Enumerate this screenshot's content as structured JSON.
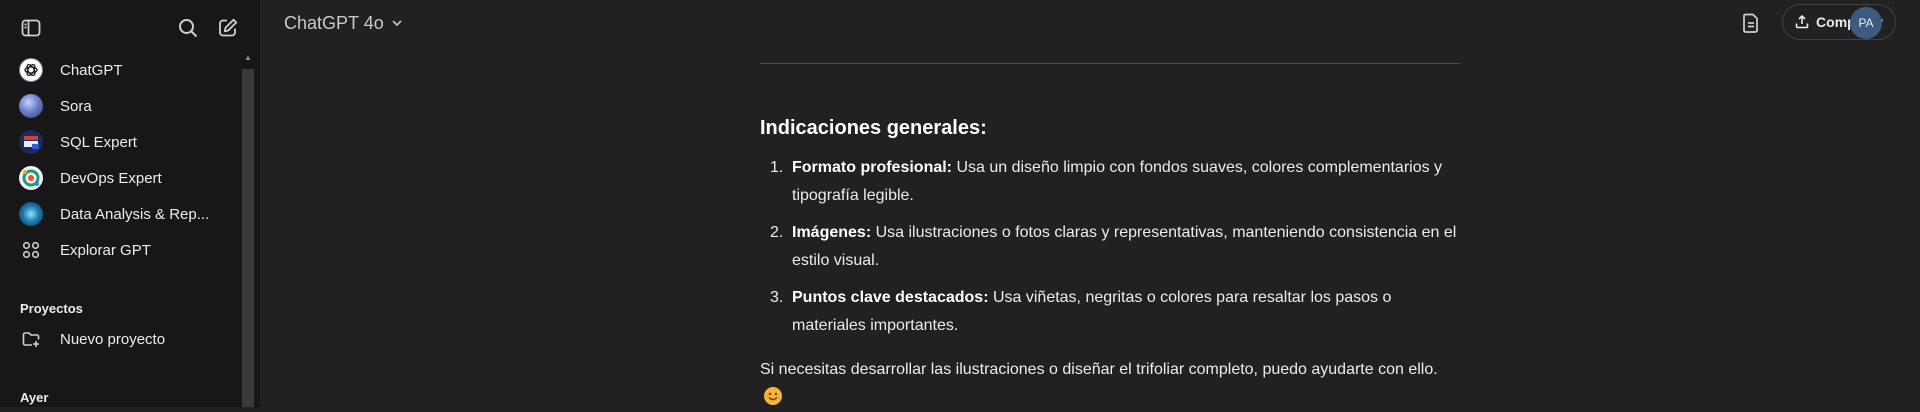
{
  "sidebar": {
    "items": [
      {
        "label": "ChatGPT",
        "icon": "openai-logo-icon"
      },
      {
        "label": "Sora",
        "icon": "sora-avatar-icon"
      },
      {
        "label": "SQL Expert",
        "icon": "sql-expert-avatar-icon"
      },
      {
        "label": "DevOps Expert",
        "icon": "devops-expert-avatar-icon"
      },
      {
        "label": "Data Analysis & Rep...",
        "icon": "data-analysis-avatar-icon"
      },
      {
        "label": "Explorar GPT",
        "icon": "grid-icon"
      }
    ],
    "projects_heading": "Proyectos",
    "new_project": "Nuevo proyecto",
    "yesterday_heading": "Ayer"
  },
  "header": {
    "model": "ChatGPT 4o",
    "share_label": "Compartir",
    "user_initials": "PA"
  },
  "message": {
    "heading": "Indicaciones generales:",
    "items": [
      {
        "num": "1.",
        "bold": "Formato profesional:",
        "text": " Usa un diseño limpio con fondos suaves, colores complementarios y tipografía legible."
      },
      {
        "num": "2.",
        "bold": "Imágenes:",
        "text": " Usa ilustraciones o fotos claras y representativas, manteniendo consistencia en el estilo visual."
      },
      {
        "num": "3.",
        "bold": "Puntos clave destacados:",
        "text": " Usa viñetas, negritas o colores para resaltar los pasos o materiales importantes."
      }
    ],
    "closing": "Si necesitas desarrollar las ilustraciones o diseñar el trifoliar completo, puedo ayudarte con ello.",
    "emoji": "smiling-face-emoji"
  },
  "colors": {
    "background": "#212121",
    "sidebar": "#171717",
    "avatar": "#3d5a80"
  }
}
